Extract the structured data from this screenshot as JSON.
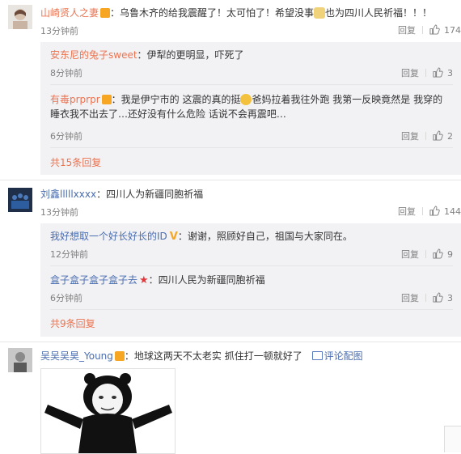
{
  "comments": [
    {
      "name": "山崎贤人之妻",
      "text_a": "：乌鲁木齐的给我震醒了！太可怕了！希望没事",
      "text_b": "也为四川人民祈福！！！",
      "time": "13分钟前",
      "reply": "回复",
      "likes": "174"
    },
    {
      "name": "刘鑫lllllxxxx",
      "text": "：四川人为新疆同胞祈福",
      "time": "13分钟前",
      "reply": "回复",
      "likes": "144"
    },
    {
      "name": "吴吴吴昊_Young",
      "text": "：地球这两天不太老实 抓住打一顿就好了",
      "pic_label": "评论配图"
    }
  ],
  "replies1": [
    {
      "name": "安东尼的兔子sweet",
      "text": "：伊犁的更明显，吓死了",
      "time": "8分钟前",
      "reply": "回复",
      "likes": "3"
    },
    {
      "name": "有毒prprpr",
      "text_a": "：我是伊宁市的 这震的真的挺",
      "text_b": "爸妈拉着我往外跑 我第一反映竟然是 我穿的",
      "line2": "睡衣我不出去了…还好没有什么危险 话说不会再震吧…",
      "time": "6分钟前",
      "reply": "回复",
      "likes": "2"
    }
  ],
  "more1": "共15条回复",
  "replies2": [
    {
      "name": "我好想取一个好长好长的ID",
      "text": "：谢谢，照顾好自己，祖国与大家同在。",
      "time": "12分钟前",
      "reply": "回复",
      "likes": "9"
    },
    {
      "name": "盒子盒子盒子盒子去",
      "text": "：四川人民为新疆同胞祈福",
      "time": "6分钟前",
      "reply": "回复",
      "likes": "3"
    }
  ],
  "more2": "共9条回复",
  "colors": {
    "accent": "#eb7350",
    "reply_bg": "#f2f2f5",
    "meta": "#808080"
  }
}
